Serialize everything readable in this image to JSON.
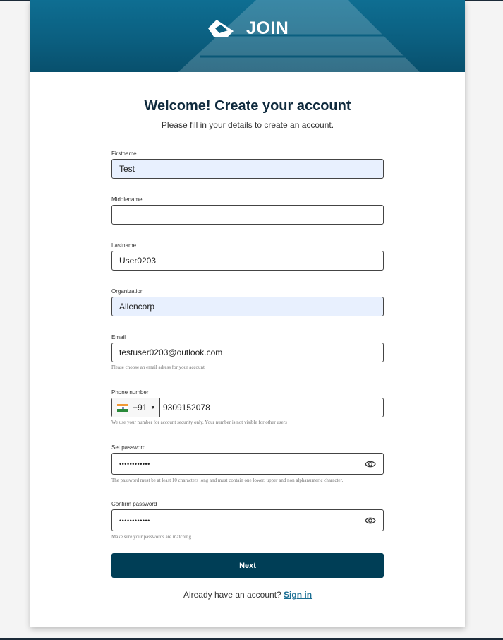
{
  "brand": {
    "name": "JOIN"
  },
  "page": {
    "title": "Welcome! Create your account",
    "subtitle": "Please fill in your details to create an account."
  },
  "fields": {
    "firstname": {
      "label": "Firstname",
      "value": "Test"
    },
    "middlename": {
      "label": "Middlename",
      "value": ""
    },
    "lastname": {
      "label": "Lastname",
      "value": "User0203"
    },
    "organization": {
      "label": "Organization",
      "value": "Allencorp"
    },
    "email": {
      "label": "Email",
      "value": "testuser0203@outlook.com",
      "help": "Please choose an email adress for your account"
    },
    "phone": {
      "label": "Phone number",
      "country_code": "+91",
      "value": "9309152078",
      "help": "We use your number for account security only. Your number is not visible for other users"
    },
    "password": {
      "label": "Set password",
      "value": "••••••••••••",
      "help": "The password must be at least 10 characters long and must contain one lower, upper and non alphanumeric character."
    },
    "confirm_password": {
      "label": "Confirm password",
      "value": "••••••••••••",
      "help": "Make sure your passwords are matching"
    }
  },
  "actions": {
    "next_label": "Next",
    "signin_prompt": "Already have an account?",
    "signin_link": "Sign in"
  },
  "icons": {
    "logo": "join-logo-icon",
    "flag": "india-flag-icon",
    "dropdown": "caret-down-icon",
    "show_password": "eye-icon"
  },
  "colors": {
    "banner": "#0b5f80",
    "primary_button": "#003e56",
    "link": "#1a6e93",
    "autofill_bg": "#e8f0fe"
  }
}
